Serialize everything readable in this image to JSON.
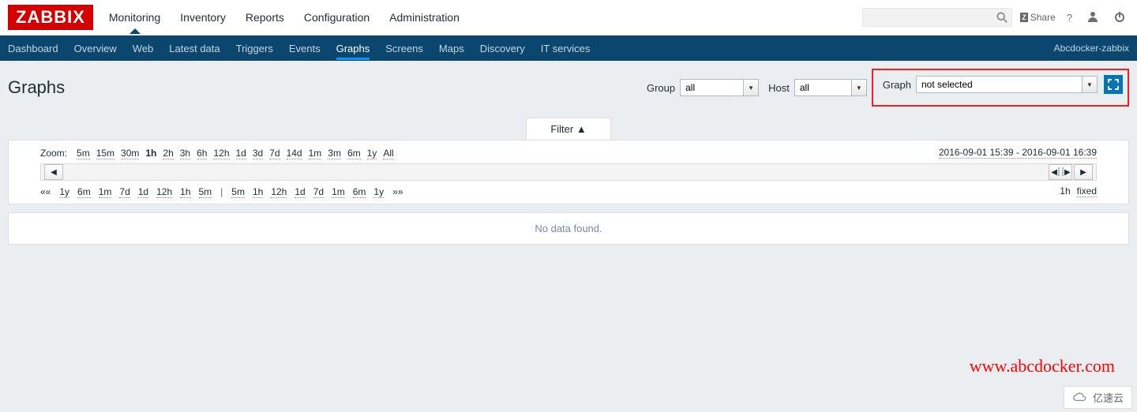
{
  "logo": "ZABBIX",
  "topnav": {
    "monitoring": "Monitoring",
    "inventory": "Inventory",
    "reports": "Reports",
    "configuration": "Configuration",
    "administration": "Administration"
  },
  "topright": {
    "share": "Share",
    "help": "?"
  },
  "subnav": {
    "dashboard": "Dashboard",
    "overview": "Overview",
    "web": "Web",
    "latest_data": "Latest data",
    "triggers": "Triggers",
    "events": "Events",
    "graphs": "Graphs",
    "screens": "Screens",
    "maps": "Maps",
    "discovery": "Discovery",
    "it_services": "IT services",
    "server_name": "Abcdocker-zabbix"
  },
  "page": {
    "title": "Graphs",
    "filter_toggle": "Filter ▲"
  },
  "filters": {
    "group_label": "Group",
    "group_value": "all",
    "host_label": "Host",
    "host_value": "all",
    "graph_label": "Graph",
    "graph_value": "not selected"
  },
  "time": {
    "zoom_label": "Zoom:",
    "zoom_opts": [
      "5m",
      "15m",
      "30m",
      "1h",
      "2h",
      "3h",
      "6h",
      "12h",
      "1d",
      "3d",
      "7d",
      "14d",
      "1m",
      "3m",
      "6m",
      "1y",
      "All"
    ],
    "zoom_active": "1h",
    "range": "2016-09-01 15:39 - 2016-09-01 16:39",
    "shift_left_prefix": "««",
    "shift_left": [
      "1y",
      "6m",
      "1m",
      "7d",
      "1d",
      "12h",
      "1h",
      "5m"
    ],
    "shift_sep": "|",
    "shift_right": [
      "5m",
      "1h",
      "12h",
      "1d",
      "7d",
      "1m",
      "6m",
      "1y"
    ],
    "shift_right_suffix": "»»",
    "current": "1h",
    "mode": "fixed"
  },
  "content": {
    "no_data": "No data found."
  },
  "watermark": "www.abcdocker.com",
  "corner_logo": "亿速云"
}
